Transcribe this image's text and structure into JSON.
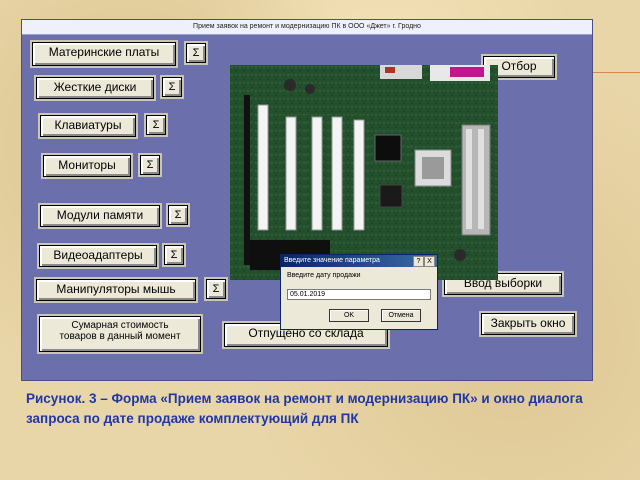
{
  "window": {
    "title": "Прием заявок на ремонт и модернизацию ПК в ООО «Джет» г. Гродно"
  },
  "buttons": {
    "motherboards": "Материнские платы",
    "hard_drives": "Жесткие диски",
    "keyboards": "Клавиатуры",
    "monitors": "Мониторы",
    "memory": "Модули памяти",
    "video": "Видеоадаптеры",
    "mice": "Манипуляторы мышь",
    "total_line1": "Сумарная стоимость",
    "total_line2": "товаров в данный момент",
    "released": "Отпущено со склада",
    "filter": "Отбор",
    "enter_selection": "Ввод выборки",
    "close_window": "Закрыть окно",
    "sum_symbol": "Σ"
  },
  "dialog": {
    "title": "Введите значение параметра",
    "help": "?",
    "close": "X",
    "prompt": "Введите дату продажи",
    "value": "05.01.2019",
    "ok": "OK",
    "cancel": "Отмена"
  },
  "caption": "Рисунок. 3 – Форма «Прием заявок на ремонт и модернизацию ПК» и окно диалога запроса по дате продаже комплектующий для ПК",
  "colors": {
    "form_background": "#6b6fab",
    "page_background": "#e9d6a8",
    "caption_text": "#1f36a8",
    "dialog_titlebar": "#0a246a"
  }
}
